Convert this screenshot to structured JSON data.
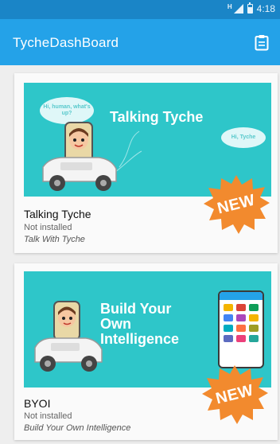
{
  "status_bar": {
    "network_type": "H",
    "time": "4:18",
    "icons": [
      "signal-icon",
      "battery-icon"
    ]
  },
  "app_bar": {
    "title": "TycheDashBoard",
    "action_icon": "clipboard-icon"
  },
  "apps": [
    {
      "banner_title": "Talking Tyche",
      "bubble_left": "Hi, human, what's up?",
      "bubble_right": "Hi, Tyche",
      "name": "Talking Tyche",
      "status": "Not installed",
      "description": "Talk With Tyche",
      "badge": "NEW"
    },
    {
      "banner_title": "Build Your Own Intelligence",
      "name": "BYOI",
      "status": "Not installed",
      "description": "Build Your Own Intelligence",
      "badge": "NEW"
    }
  ],
  "colors": {
    "status_bar": "#1a85c7",
    "app_bar": "#24a2e8",
    "banner": "#2ec6c9",
    "badge": "#f28a2e"
  }
}
